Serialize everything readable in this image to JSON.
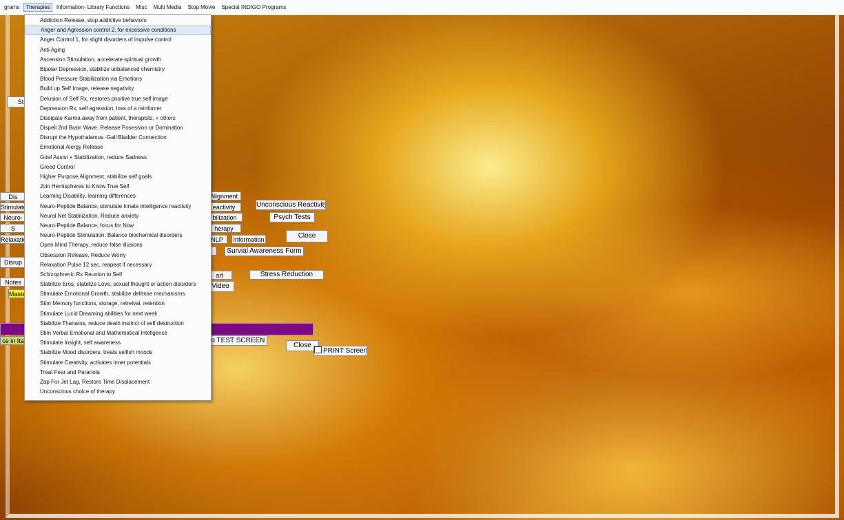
{
  "menubar": {
    "items": [
      "grams",
      "Therapies",
      "Information- Library Functions",
      "Misc",
      "Multi Media",
      "Stop Movie",
      "Special INDIGO Programs"
    ],
    "open_index": 1
  },
  "therapies_menu": {
    "hover_index": 1,
    "items": [
      "Addiction Release, stop addictive behaviors",
      "Anger and Agression control 2, for excessive conditions",
      "Anger Control 1, for slight disorders of impulse control",
      "Anti Aging",
      "Ascension Stimulation, accelerate spiritual growth",
      "Bipolar Depression, stabilize unbalanced chemistry",
      "Blood Pressure Stabilization via Emotions",
      "Build up Self Image, release negativity",
      "Delusion of Self Rx, restores positive true self image",
      "Depression Rx, self agression, loss of a reinforcer",
      "Dissipate Karma away from patient, therapists, + others",
      "Dispell 2nd Brain Wave, Release Posession or Domination",
      "Disrupt the Hypothalamus -Gall Bladder Connection",
      "Emotional Alergy Release",
      "Grief Assist + Stabilization, reduce Sadness",
      "Greed Control",
      "Higher Purpose Alignment, stabilize self goals",
      "Join Hemispheres to Know True Self",
      "Learning Disability, learning differences",
      "Neuro-Peptide Balance, stimulate innate intelligence reactivity",
      "Neural Net Stabilization, Reduce anxiety",
      "Neuro-Peptide Balance, focus for Now",
      "Neuro-Peptide Stimulation, Balance biochemical disorders",
      "Open Mind Therapy, reduce false illusions",
      "Obsession Release, Reduce Worry",
      "Relaxation Pulse 12 sec, reapeat if necessary",
      "Schizophrenic Rx Reunion to Self",
      "Stabilize Eros, stabilize Love, sexual thought or action disorders",
      "Stimulate Emotional Growth, stabilize defense mechanisms",
      "Stim Memory functions, storage, retreival, retention",
      "Stimulate Lucid Dreaming abilities for next week",
      "Stabilize Thanatos, reduce death instinct of self destruction",
      "Stim Verbal Emotional and Mathematical Intellgence",
      "Stimulate Insight, self awareness",
      "Stabilize Mood disorders, treats selfish moods",
      "Stimulate Creativity, activates inner potentials",
      "Treat Fear and Paranoia",
      "Zap For Jet Lag, Restore Time Displacement",
      "Unconscious choice of therapy"
    ]
  },
  "left_buttons": {
    "st": "St",
    "dis": "Dis",
    "stimulate": "Stimulate",
    "neuro": "Neuro-",
    "s": "S",
    "relaxation": "Relaxation",
    "disrup": "Disrup",
    "notes": "Notes",
    "maste": "Maste",
    "ice_in": "ce in Ita"
  },
  "right_buttons": {
    "alignment": "Alignment",
    "reactivity": "eactivity",
    "stabilization": "bilization",
    "therapy": "herapy",
    "nlp": "NLP",
    "information": "Information",
    "close_top": "Close",
    "unconscious_reactivity": "Unconscious Reactivity",
    "psych_tests": "Psych Tests",
    "survival_form": "Survial Awareness Form",
    "art": "art",
    "stress_reduction": "Stress Reduction",
    "video": "Video",
    "test_screen": "to TEST SCREEN",
    "close_bottom": "Close",
    "print_screen": "PRINT Screen"
  },
  "colors": {
    "purple_bar": "#7a0a86",
    "master_button": "#f3ec2a",
    "menu_hover": "#dde9f7"
  }
}
